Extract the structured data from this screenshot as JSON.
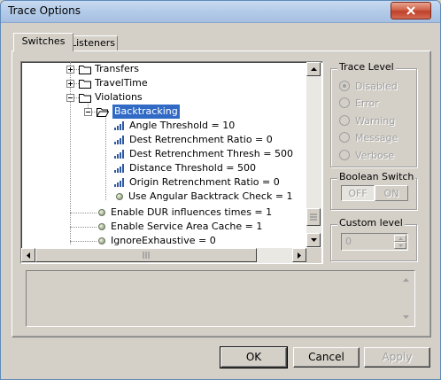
{
  "window": {
    "title": "Trace Options"
  },
  "tabs": [
    {
      "label": "Switches"
    },
    {
      "label": "Listeners"
    }
  ],
  "tree": {
    "items": [
      {
        "label": "Transfers",
        "type": "folder",
        "expander": "plus"
      },
      {
        "label": "TravelTime",
        "type": "folder",
        "expander": "plus"
      },
      {
        "label": "Violations",
        "type": "folder",
        "expander": "minus"
      },
      {
        "label": "Backtracking",
        "type": "folder",
        "expander": "minus",
        "selected": true
      },
      {
        "label": "Angle Threshold = 10",
        "type": "level"
      },
      {
        "label": "Dest Retrenchment Ratio = 0",
        "type": "level"
      },
      {
        "label": "Dest Retrenchment Thresh = 500",
        "type": "level"
      },
      {
        "label": "Distance Threshold = 500",
        "type": "level"
      },
      {
        "label": "Origin Retrenchment Ratio = 0",
        "type": "level"
      },
      {
        "label": "Use Angular Backtrack Check = 1",
        "type": "boolean"
      },
      {
        "label": "Enable DUR influences times = 1",
        "type": "boolean"
      },
      {
        "label": "Enable Service Area Cache = 1",
        "type": "boolean"
      },
      {
        "label": "IgnoreExhaustive = 0",
        "type": "boolean"
      }
    ]
  },
  "trace_level": {
    "label": "Trace Level",
    "options": [
      {
        "label": "Disabled",
        "checked": true
      },
      {
        "label": "Error",
        "checked": false
      },
      {
        "label": "Warning",
        "checked": false
      },
      {
        "label": "Message",
        "checked": false
      },
      {
        "label": "Verbose",
        "checked": false
      }
    ]
  },
  "boolean_switch": {
    "label": "Boolean Switch",
    "off_label": "OFF",
    "on_label": "ON"
  },
  "custom_level": {
    "label": "Custom level",
    "value": "0"
  },
  "buttons": {
    "ok": "OK",
    "cancel": "Cancel",
    "apply": "Apply"
  },
  "colors": {
    "selection": "#316ac5",
    "face": "#d4d0c8",
    "titlebar": "#b3cbe8",
    "close": "#d0634a"
  }
}
